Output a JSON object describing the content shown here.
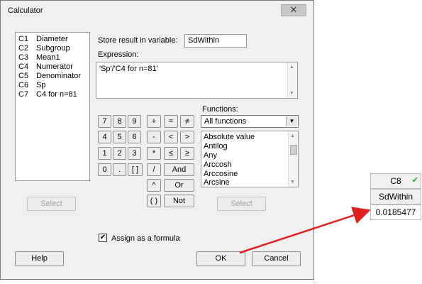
{
  "dialog": {
    "title": "Calculator",
    "close_glyph": "✕",
    "variables": [
      {
        "col": "C1",
        "name": "Diameter"
      },
      {
        "col": "C2",
        "name": "Subgroup"
      },
      {
        "col": "C3",
        "name": "Mean1"
      },
      {
        "col": "C4",
        "name": "Numerator"
      },
      {
        "col": "C5",
        "name": "Denominator"
      },
      {
        "col": "C6",
        "name": "Sp"
      },
      {
        "col": "C7",
        "name": "C4 for n=81"
      }
    ],
    "store_label": "Store result in variable:",
    "store_value": "SdWithin",
    "expression_label": "Expression:",
    "expression_value": "'Sp'/'C4 for n=81'",
    "keypad": {
      "k7": "7",
      "k8": "8",
      "k9": "9",
      "plus": "+",
      "eq": "=",
      "neq": "≠",
      "k4": "4",
      "k5": "5",
      "k6": "6",
      "minus": "-",
      "lt": "<",
      "gt": ">",
      "k1": "1",
      "k2": "2",
      "k3": "3",
      "mult": "*",
      "le": "≤",
      "ge": "≥",
      "k0": "0",
      "dot": ".",
      "brackets": "[ ]",
      "div": "/",
      "and": "And",
      "pow": "^",
      "or": "Or",
      "parens": "( )",
      "not": "Not"
    },
    "functions_label": "Functions:",
    "functions_selected": "All functions",
    "functions": [
      "Absolute value",
      "Antilog",
      "Any",
      "Arccosh",
      "Arccosine",
      "Arcsine"
    ],
    "select_left": "Select",
    "select_right": "Select",
    "assign_label": "Assign as a formula",
    "assign_checked": true,
    "help": "Help",
    "ok": "OK",
    "cancel": "Cancel"
  },
  "worksheet": {
    "column": "C8",
    "name": "SdWithin",
    "value": "0.0185477",
    "check_glyph": "✔"
  },
  "colors": {
    "arrow": "#e0201f",
    "checkmark": "#2aa02a"
  }
}
